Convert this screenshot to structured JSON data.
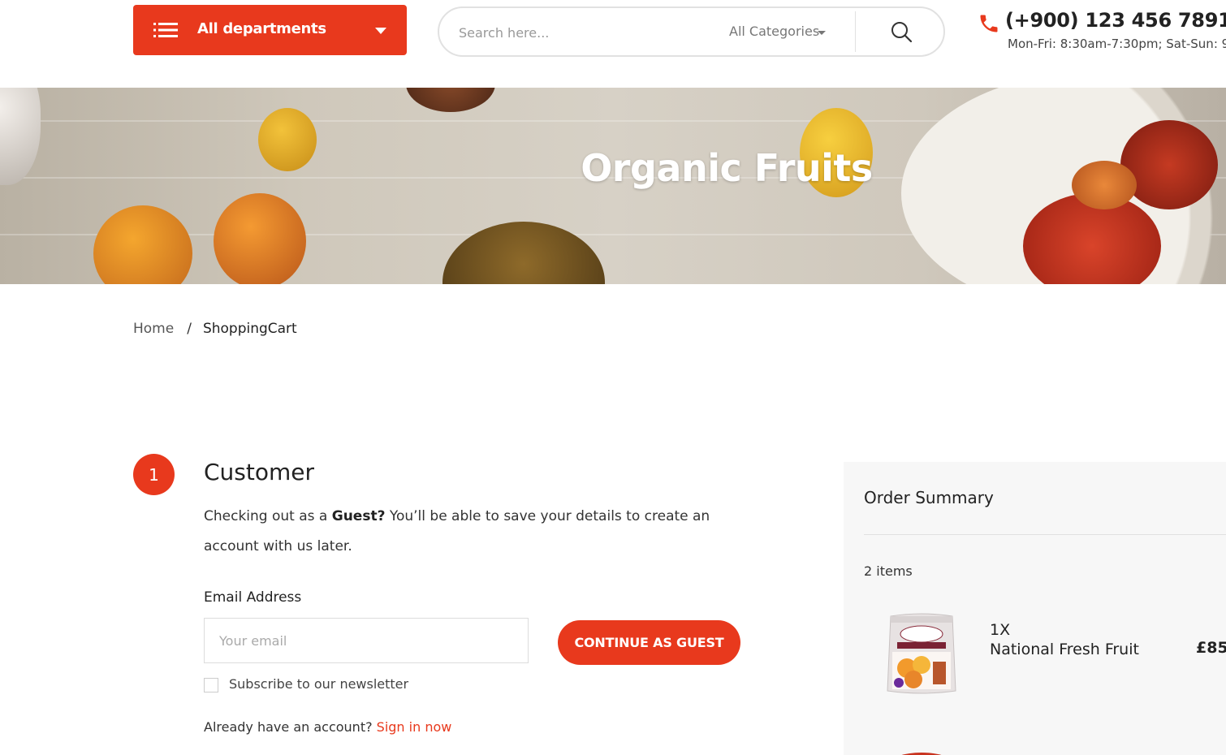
{
  "header": {
    "departments_label": "All departments",
    "search": {
      "placeholder": "Search here...",
      "category_selected": "All Categories"
    },
    "phone": "(+900) 123 456 7891",
    "hours": "Mon-Fri: 8:30am-7:30pm; Sat-Sun: 9"
  },
  "banner": {
    "title": "Organic Fruits"
  },
  "breadcrumb": {
    "home": "Home",
    "separator": "/",
    "current": "ShoppingCart"
  },
  "customer": {
    "step_number": "1",
    "title": "Customer",
    "guest_prefix": "Checking out as a ",
    "guest_bold": "Guest?",
    "guest_suffix": " You’ll be able to save your details to create an account with us later.",
    "email_label": "Email Address",
    "email_placeholder": "Your email",
    "continue_button": "CONTINUE AS GUEST",
    "newsletter_label": "Subscribe to our newsletter",
    "account_prompt": "Already have an account? ",
    "sign_in_link": "Sign in now"
  },
  "order_summary": {
    "title": "Order Summary",
    "item_count": "2 items",
    "items": [
      {
        "quantity": "1X",
        "name": "National Fresh Fruit",
        "price": "£85"
      }
    ]
  },
  "colors": {
    "accent": "#e8391d",
    "summary_bg": "#f7f7f7"
  },
  "icons": [
    "menu-icon",
    "chevron-down-icon",
    "search-icon",
    "phone-icon"
  ]
}
